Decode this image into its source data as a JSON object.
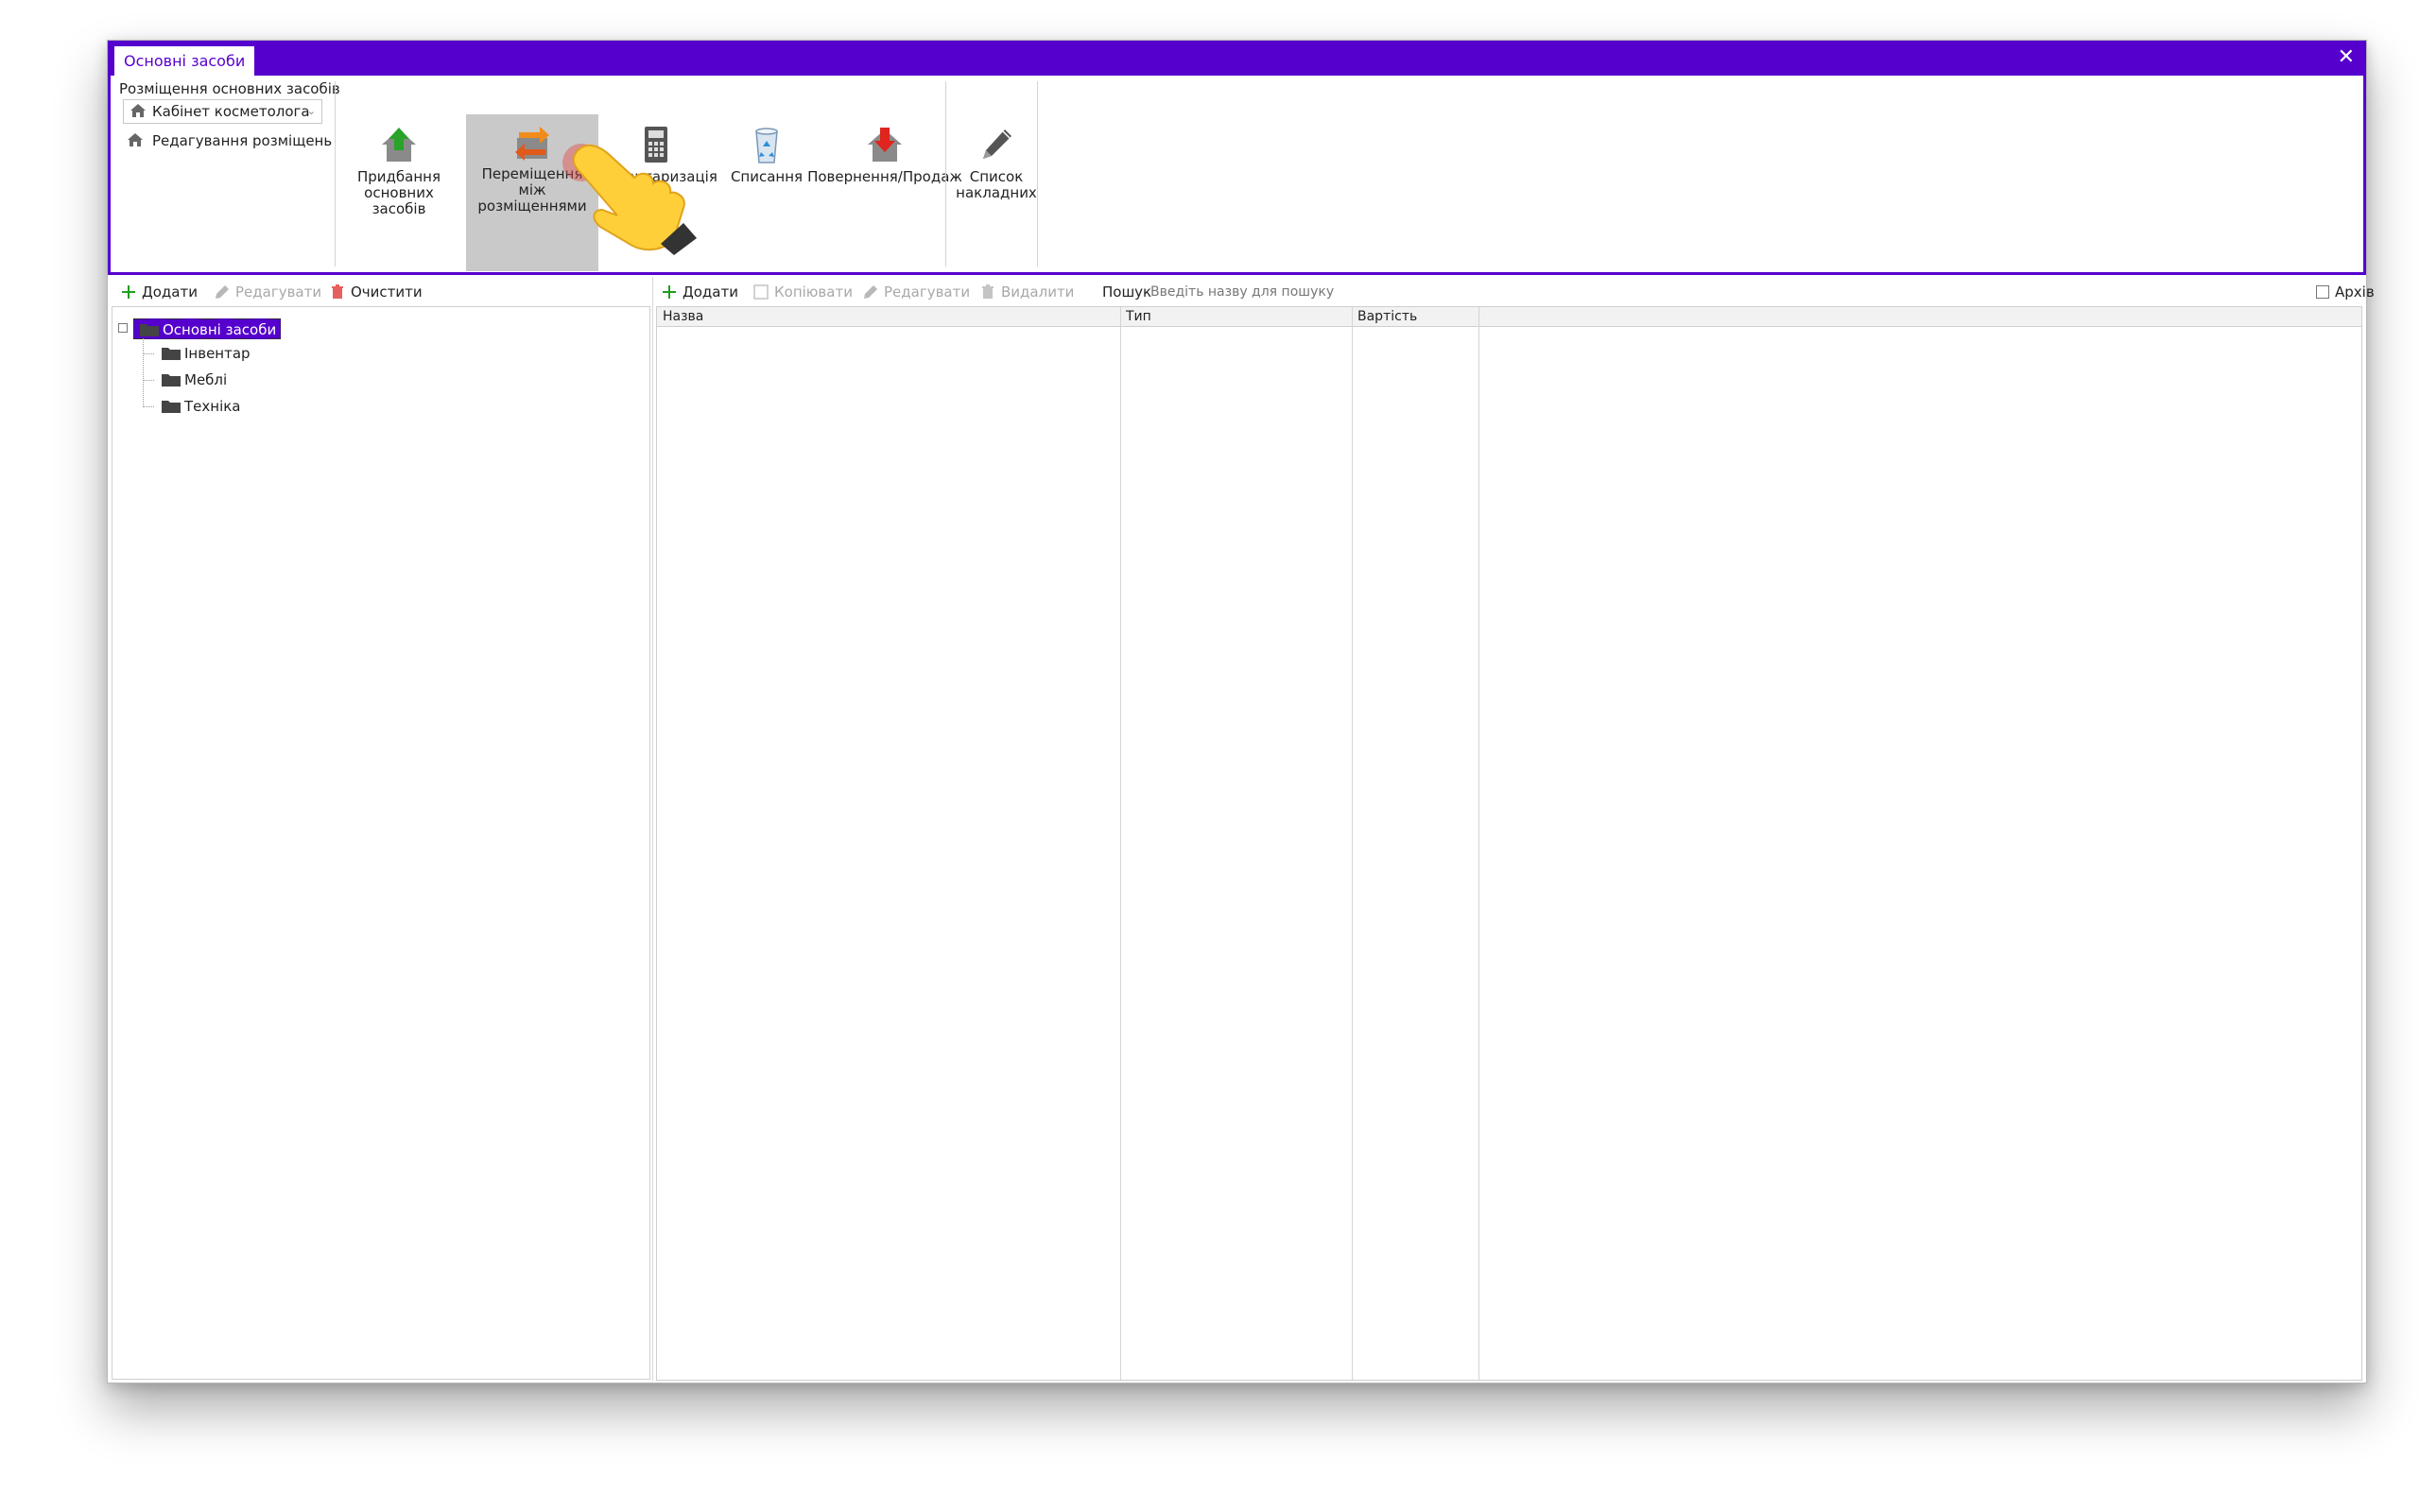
{
  "window": {
    "tab_title": "Основні засоби",
    "close_glyph": "✕"
  },
  "ribbon": {
    "location_group_label": "Розміщення основних засобів",
    "location_select_value": "Кабінет косметолога",
    "edit_locations_label": "Редагування розміщень",
    "buttons": [
      {
        "label": "Придбання основних засобів",
        "icon": "house-up-arrow-icon"
      },
      {
        "label": "Переміщення між розміщеннями",
        "icon": "transfer-arrows-icon",
        "active": true
      },
      {
        "label": "Інвентаризація",
        "icon": "calculator-icon"
      },
      {
        "label": "Списання",
        "icon": "recycle-bin-icon"
      },
      {
        "label": "Повернення/Продаж",
        "icon": "house-down-arrow-icon"
      },
      {
        "label": "Список накладних",
        "icon": "pencil-icon"
      }
    ]
  },
  "left_toolbar": {
    "add": "Додати",
    "edit": "Редагувати",
    "clear": "Очистити"
  },
  "tree": {
    "root": "Основні засоби",
    "children": [
      "Інвентар",
      "Меблі",
      "Техніка"
    ]
  },
  "right_toolbar": {
    "add": "Додати",
    "copy": "Копіювати",
    "edit": "Редагувати",
    "delete": "Видалити",
    "search_label": "Пошук",
    "search_placeholder": "Введіть назву для пошуку",
    "archive_label": "Архів"
  },
  "grid": {
    "columns": [
      "Назва",
      "Тип",
      "Вартість"
    ]
  },
  "colors": {
    "accent": "#5500cc",
    "active_button": "#c9c9c9"
  }
}
